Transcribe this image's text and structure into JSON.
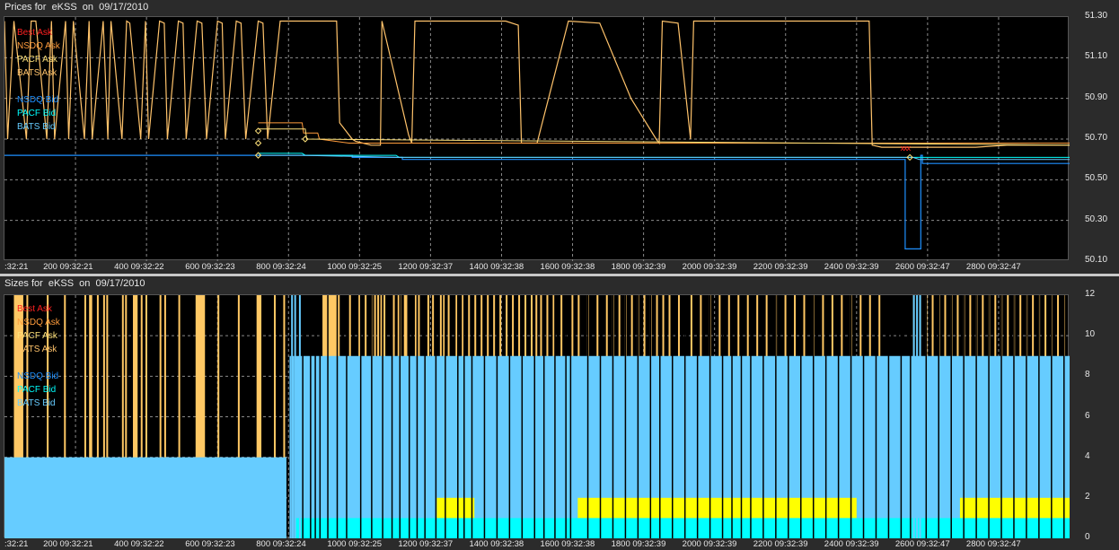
{
  "colors": {
    "best_ask": "#ff2020",
    "nsdq_ask": "#ff9c3c",
    "pacf_ask": "#ffe27a",
    "bats_ask": "#ffc36b",
    "nsdq_bid": "#1e90ff",
    "pacf_bid": "#00ffff",
    "bats_bid": "#66ccff",
    "ask_size": "#ffc864",
    "bid_size": "#66ccff",
    "pacf_size": "#ffff00",
    "cyan_size": "#00ffff"
  },
  "legend": [
    {
      "label": "Best Ask",
      "key": "best_ask"
    },
    {
      "label": "NSDQ Ask",
      "key": "nsdq_ask"
    },
    {
      "label": "PACF Ask",
      "key": "pacf_ask"
    },
    {
      "label": "BATS Ask",
      "key": "bats_ask"
    },
    {
      "label": "NSDQ Bid",
      "key": "nsdq_bid"
    },
    {
      "label": "PACF Bid",
      "key": "pacf_bid"
    },
    {
      "label": "BATS Bid",
      "key": "bats_bid"
    }
  ],
  "chart_data": [
    {
      "type": "line",
      "title": "Prices for  eKSS  on  09/17/2010",
      "ylim": [
        50.1,
        51.3
      ],
      "yticks": [
        "51.30",
        "51.10",
        "50.90",
        "50.70",
        "50.50",
        "50.30",
        "50.10"
      ],
      "xlim": [
        -300,
        3100
      ],
      "xticks": [
        ":32:21",
        "200 09:32:21",
        "400 09:32:22",
        "600 09:32:23",
        "800 09:32:24",
        "1000 09:32:25",
        "1200 09:32:37",
        "1400 09:32:38",
        "1600 09:32:38",
        "1800 09:32:39",
        "2000 09:32:39",
        "2200 09:32:39",
        "2400 09:32:39",
        "2600 09:32:47",
        "2800 09:32:47"
      ],
      "grid": true,
      "legend_position": "top-left",
      "series": [
        {
          "name": "NSDQ Ask",
          "key": "bats_ask",
          "x": [
            -300,
            -290,
            -270,
            -230,
            -215,
            -200,
            -165,
            -150,
            -140,
            -105,
            -95,
            -80,
            -45,
            -30,
            -20,
            15,
            30,
            40,
            75,
            90,
            100,
            135,
            150,
            160,
            195,
            210,
            220,
            255,
            270,
            280,
            315,
            330,
            345,
            380,
            395,
            405,
            440,
            455,
            470,
            510,
            525,
            540,
            580,
            600,
            603,
            760,
            770,
            800,
            810,
            820,
            870,
            900,
            905,
            990,
            1000,
            1010,
            1100,
            1200,
            1300,
            1340,
            1350,
            1400,
            1500,
            1600,
            1700,
            1780,
            1790,
            1800,
            1850,
            1890,
            1900,
            2000,
            2100,
            2200,
            2300,
            2400,
            2460,
            2470,
            2500,
            2600,
            2700,
            2800,
            2900,
            3000,
            3100
          ],
          "y": [
            51.28,
            50.7,
            51.28,
            50.7,
            51.28,
            51.28,
            50.7,
            51.28,
            50.7,
            51.28,
            50.7,
            51.28,
            50.7,
            51.28,
            50.7,
            51.28,
            50.7,
            51.28,
            50.7,
            51.28,
            51.27,
            50.7,
            51.28,
            50.7,
            51.28,
            51.27,
            50.7,
            51.28,
            51.27,
            50.7,
            51.28,
            51.27,
            50.7,
            51.28,
            51.27,
            50.7,
            51.28,
            51.27,
            50.7,
            51.28,
            51.27,
            50.7,
            51.28,
            51.28,
            51.28,
            51.28,
            50.78,
            50.72,
            50.7,
            50.69,
            50.67,
            50.67,
            51.28,
            50.72,
            50.68,
            51.28,
            51.28,
            51.28,
            51.28,
            51.26,
            50.68,
            50.68,
            51.28,
            51.27,
            50.9,
            50.7,
            50.68,
            51.28,
            51.27,
            50.7,
            51.28,
            51.28,
            51.28,
            51.28,
            51.28,
            51.28,
            51.28,
            50.67,
            50.66,
            50.66,
            50.66,
            50.66,
            50.67,
            50.67,
            50.67
          ]
        },
        {
          "name": "NSDQ Bid",
          "key": "nsdq_bid",
          "x": [
            -300,
            800,
            810,
            960,
            970,
            1190,
            1200,
            2570,
            2575,
            2585,
            2620,
            2625,
            2630,
            3100
          ],
          "y": [
            50.62,
            50.62,
            50.61,
            50.61,
            50.6,
            50.6,
            50.6,
            50.6,
            50.16,
            50.16,
            50.16,
            50.62,
            50.58,
            50.58
          ]
        }
      ]
    },
    {
      "type": "bar",
      "title": "Sizes for  eKSS  on  09/17/2010",
      "ylim": [
        0,
        12
      ],
      "yticks": [
        "12",
        "10",
        "8",
        "6",
        "4",
        "2",
        "0"
      ],
      "xlim": [
        -300,
        3100
      ],
      "xticks": [
        ":32:21",
        "200 09:32:21",
        "400 09:32:22",
        "600 09:32:23",
        "800 09:32:24",
        "1000 09:32:25",
        "1200 09:32:37",
        "1400 09:32:38",
        "1600 09:32:38",
        "1800 09:32:39",
        "2000 09:32:39",
        "2200 09:32:39",
        "2400 09:32:39",
        "2600 09:32:47",
        "2800 09:32:47"
      ],
      "grid": true,
      "legend_position": "top-left",
      "bid_level": 4,
      "bid_level_after": 9,
      "pacf_level": 2,
      "cyan_level": 1,
      "ask_spikes_x": [
        -230,
        -165,
        -110,
        -45,
        -5,
        15,
        25,
        75,
        85,
        135,
        150,
        195,
        210,
        255,
        320,
        380,
        445,
        505,
        560,
        590,
        800,
        830,
        850,
        870,
        880,
        890,
        900,
        910,
        940,
        955,
        960,
        975,
        980,
        1010,
        1020,
        1050,
        1065,
        1090,
        1100,
        1115,
        1140,
        1160,
        1180,
        1200,
        1220,
        1240,
        1260,
        1280,
        1300,
        1320,
        1340,
        1360,
        1380,
        1395,
        1410,
        1430,
        1450,
        1475,
        1510,
        1530,
        1560,
        1590,
        1620,
        1640,
        1660,
        1680,
        1700,
        1720,
        1740,
        1760,
        1780,
        1800,
        1820,
        1850,
        1890,
        1920,
        1950,
        1980,
        2010,
        2040,
        2070,
        2100,
        2130,
        2160,
        2190,
        2220,
        2250,
        2280,
        2310,
        2340,
        2370,
        2400,
        2430,
        2460,
        2490,
        2600,
        2620,
        2640,
        2660,
        2680,
        2700,
        2720,
        2740,
        2760,
        2780,
        2800,
        2820,
        2840,
        2860,
        2880,
        2900,
        2920,
        2940,
        2960,
        2980,
        3000,
        3020,
        3040,
        3060,
        3080
      ],
      "ask_blocks": [
        [
          -270,
          -240
        ],
        [
          -30,
          -20
        ],
        [
          110,
          125
        ],
        [
          310,
          340
        ],
        [
          505,
          520
        ],
        [
          715,
          770
        ]
      ],
      "gaps_x": [
        615,
        625,
        650,
        675,
        690,
        705,
        730,
        760,
        790,
        835,
        870,
        905,
        935,
        960,
        990,
        1015,
        1040,
        1075,
        1105,
        1145,
        1165,
        1190,
        1230,
        1270,
        1310,
        1350,
        1390,
        1420,
        1455,
        1490,
        1505,
        1560,
        1600,
        1640,
        1680,
        1720,
        1760,
        1790,
        1830,
        1870,
        1910,
        1950,
        1990,
        2020,
        2050,
        2080,
        2120,
        2160,
        2200,
        2240,
        2280,
        2320,
        2360,
        2400,
        2440,
        2480,
        2520,
        2560,
        2590,
        2640,
        2680,
        2720,
        2760,
        2800,
        2840,
        2880,
        2920,
        2960,
        3000,
        3040,
        3080
      ]
    }
  ]
}
